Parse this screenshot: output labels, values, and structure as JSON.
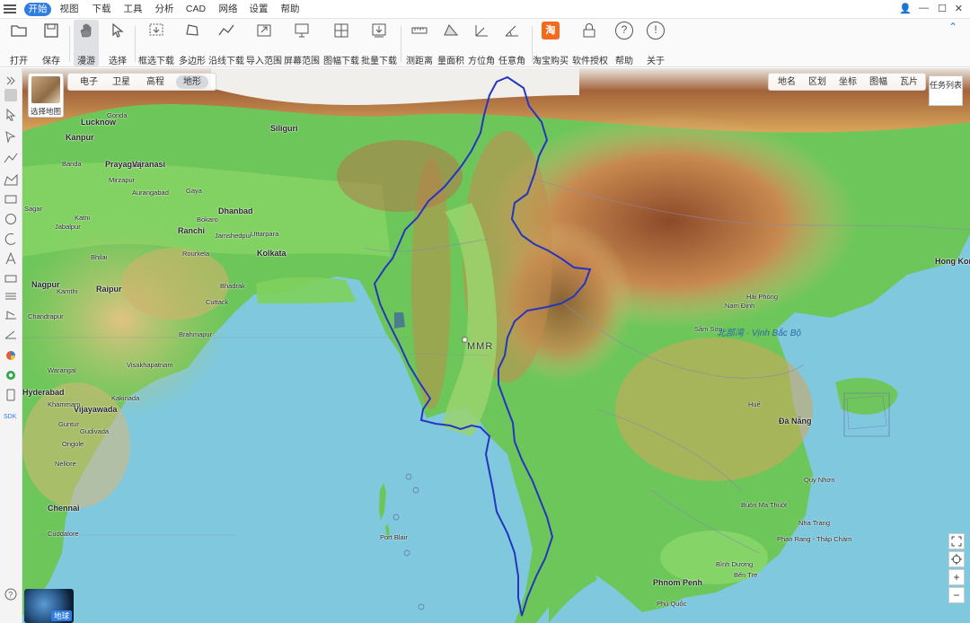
{
  "menu": {
    "tabs": [
      "开始",
      "视图",
      "下载",
      "工具",
      "分析",
      "CAD",
      "网络",
      "设置",
      "帮助"
    ],
    "active": "开始"
  },
  "window_controls": {
    "user": "👤",
    "minimize": "—",
    "maximize": "☐",
    "close": "✕"
  },
  "collapse_icon": "⌃",
  "toolbar": [
    {
      "label": "打开",
      "icon": "folder-icon"
    },
    {
      "label": "保存",
      "icon": "save-icon"
    },
    {
      "label": "漫游",
      "icon": "hand-icon"
    },
    {
      "label": "选择",
      "icon": "cursor-icon"
    },
    {
      "label": "框选下载",
      "icon": "box-download-icon"
    },
    {
      "label": "多边形",
      "icon": "polygon-icon"
    },
    {
      "label": "沿线下载",
      "icon": "line-download-icon"
    },
    {
      "label": "导入范围",
      "icon": "import-icon"
    },
    {
      "label": "屏幕范围",
      "icon": "screen-icon"
    },
    {
      "label": "图幅下载",
      "icon": "sheet-icon"
    },
    {
      "label": "批量下载",
      "icon": "batch-download-icon"
    },
    {
      "label": "测距离",
      "icon": "ruler-icon"
    },
    {
      "label": "量面积",
      "icon": "area-icon"
    },
    {
      "label": "方位角",
      "icon": "azimuth-icon"
    },
    {
      "label": "任意角",
      "icon": "angle-icon"
    },
    {
      "label": "淘宝购买",
      "icon": "taobao-icon",
      "badge": "淘"
    },
    {
      "label": "软件授权",
      "icon": "lock-icon"
    },
    {
      "label": "帮助",
      "icon": "help-icon",
      "glyph": "?"
    },
    {
      "label": "关于",
      "icon": "info-icon",
      "glyph": "!"
    }
  ],
  "map": {
    "layer_tabs": [
      "电子",
      "卫星",
      "高程",
      "地形"
    ],
    "active_layer": "地形",
    "right_tabs": [
      "地名",
      "区划",
      "坐标",
      "图幅",
      "瓦片"
    ],
    "thumb_label": "选择地图",
    "task_list": "任务列表",
    "globe_label": "地球",
    "zoom_in": "+",
    "zoom_out": "−",
    "country_label": "MMR",
    "sea_label": "北部湾 · Vịnh Bắc Bộ",
    "labels": [
      {
        "t": "Kanpur"
      },
      {
        "t": "Lucknow"
      },
      {
        "t": "Gonda"
      },
      {
        "t": "Prayagraj"
      },
      {
        "t": "Varanasi"
      },
      {
        "t": "Banda"
      },
      {
        "t": "Mirzapur"
      },
      {
        "t": "Aurangabad"
      },
      {
        "t": "Gaya"
      },
      {
        "t": "Sagar"
      },
      {
        "t": "Jabalpur"
      },
      {
        "t": "Ranchi"
      },
      {
        "t": "Dhanbad"
      },
      {
        "t": "Siliguri"
      },
      {
        "t": "Kolkata"
      },
      {
        "t": "Raipur"
      },
      {
        "t": "Nagpur"
      },
      {
        "t": "Bhilai"
      },
      {
        "t": "Cuttack"
      },
      {
        "t": "Rourkela"
      },
      {
        "t": "Jamshedpur"
      },
      {
        "t": "Chandrapur"
      },
      {
        "t": "Warangal"
      },
      {
        "t": "Hyderabad"
      },
      {
        "t": "Vijayawada"
      },
      {
        "t": "Guntur"
      },
      {
        "t": "Nellore"
      },
      {
        "t": "Chennai"
      },
      {
        "t": "Cuddalore"
      },
      {
        "t": "Port Blair"
      },
      {
        "t": "Visakhapatnam"
      },
      {
        "t": "Kakinada"
      },
      {
        "t": "Brahmapur"
      },
      {
        "t": "Bhadrak"
      },
      {
        "t": "Hong Kong"
      },
      {
        "t": "Đà Nẵng"
      },
      {
        "t": "Phnom Penh"
      },
      {
        "t": "Phan Rang - Tháp Chàm"
      },
      {
        "t": "Bình Dương"
      },
      {
        "t": "Bến Tre"
      },
      {
        "t": "Phú Quốc"
      },
      {
        "t": "Quy Nhơn"
      },
      {
        "t": "Buôn Ma Thuột"
      },
      {
        "t": "Nha Trang"
      },
      {
        "t": "Huế"
      },
      {
        "t": "Sầm Sơn"
      },
      {
        "t": "Nam Định"
      },
      {
        "t": "Hải Phòng"
      },
      {
        "t": "Uttarpara"
      },
      {
        "t": "Bokaro"
      },
      {
        "t": "Katni"
      },
      {
        "t": "Kamthi"
      },
      {
        "t": "Khammam"
      },
      {
        "t": "Gudivada"
      },
      {
        "t": "Ongole"
      }
    ]
  }
}
